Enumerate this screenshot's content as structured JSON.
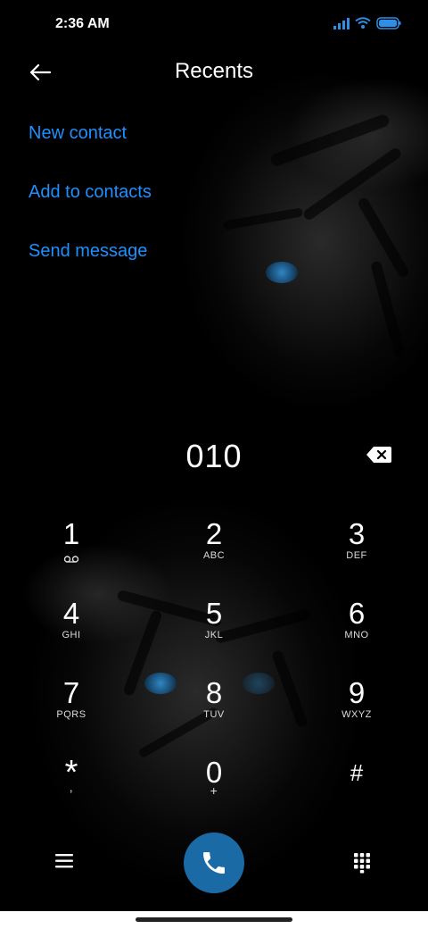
{
  "status_bar": {
    "time": "2:36 AM"
  },
  "header": {
    "title": "Recents"
  },
  "actions": [
    {
      "label": "New contact"
    },
    {
      "label": "Add to contacts"
    },
    {
      "label": "Send message"
    }
  ],
  "dialer": {
    "number": "010",
    "keys": [
      {
        "digit": "1",
        "letters": ""
      },
      {
        "digit": "2",
        "letters": "ABC"
      },
      {
        "digit": "3",
        "letters": "DEF"
      },
      {
        "digit": "4",
        "letters": "GHI"
      },
      {
        "digit": "5",
        "letters": "JKL"
      },
      {
        "digit": "6",
        "letters": "MNO"
      },
      {
        "digit": "7",
        "letters": "PQRS"
      },
      {
        "digit": "8",
        "letters": "TUV"
      },
      {
        "digit": "9",
        "letters": "WXYZ"
      },
      {
        "digit": "*",
        "letters": ","
      },
      {
        "digit": "0",
        "letters": "+"
      },
      {
        "digit": "#",
        "letters": ""
      }
    ]
  },
  "icons": {
    "back": "arrow-left-icon",
    "backspace": "backspace-icon",
    "voicemail": "voicemail-icon",
    "menu": "menu-icon",
    "call": "phone-icon",
    "dialpad": "dialpad-icon"
  },
  "colors": {
    "accent": "#1e90ff",
    "call_button": "#1a6aa6",
    "signal": "#2f8fe6"
  }
}
